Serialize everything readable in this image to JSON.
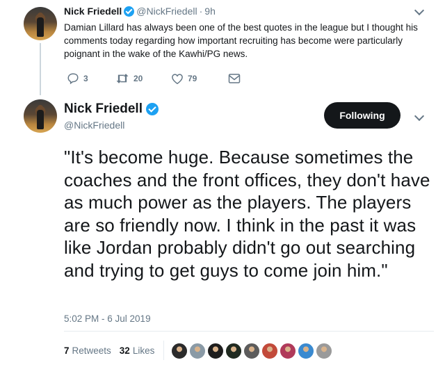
{
  "reply_tweet": {
    "name": "Nick Friedell",
    "handle": "@NickFriedell",
    "time": "9h",
    "text": "Damian Lillard has always been one of the best quotes in the league but I thought his comments today regarding how important recruiting has become were particularly poignant in the wake of the Kawhi/PG news.",
    "replies": "3",
    "retweets": "20",
    "likes": "79"
  },
  "main_tweet": {
    "name": "Nick Friedell",
    "handle": "@NickFriedell",
    "follow_label": "Following",
    "text": "\"It's become huge. Because sometimes the coaches and the front offices, they don't have as much power as the players. The players are so friendly now. I think in the past it was like Jordan probably didn't go out searching and trying to get guys to come join him.\"",
    "timestamp": "5:02 PM - 6 Jul 2019",
    "retweet_count": "7",
    "retweet_label": "Retweets",
    "like_count": "32",
    "like_label": "Likes"
  },
  "colors": {
    "verified": "#1da1f2",
    "secondary_text": "#657786",
    "follow_button": "#14171a"
  },
  "liker_colors": [
    "#2b2b2b",
    "#8a9aa6",
    "#1e1e1e",
    "#202a20",
    "#5c5c5c",
    "#c24a3a",
    "#b03a5a",
    "#3a8ad0",
    "#9a9a9a"
  ]
}
